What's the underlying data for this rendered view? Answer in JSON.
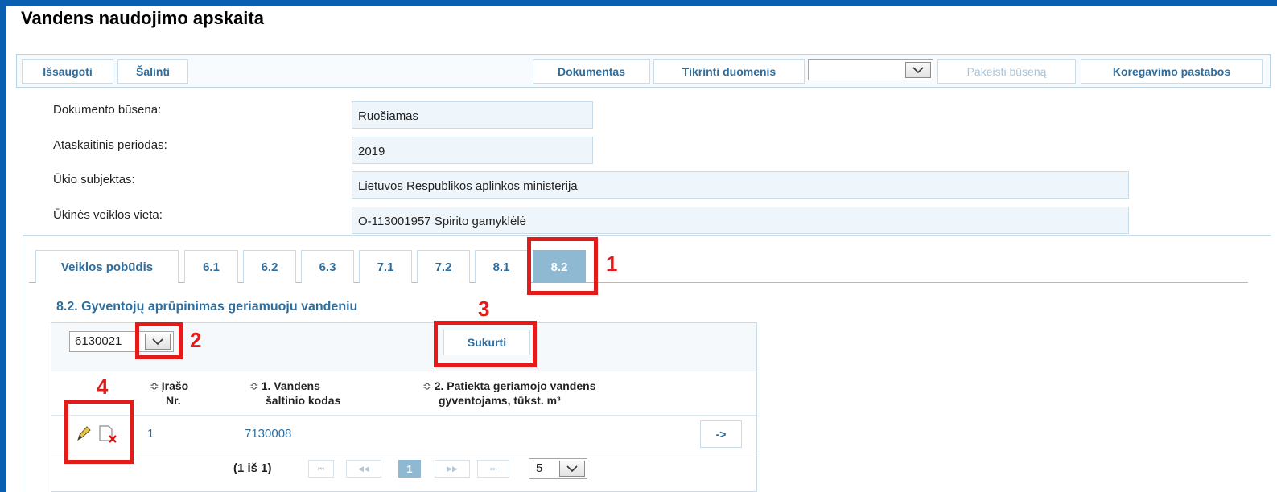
{
  "page": {
    "title": "Vandens naudojimo apskaita"
  },
  "toolbar": {
    "save": "Išsaugoti",
    "delete": "Šalinti",
    "document": "Dokumentas",
    "check": "Tikrinti duomenis",
    "status_select_value": "",
    "change_status": "Pakeisti būseną",
    "correction_notes": "Koregavimo pastabos"
  },
  "form": {
    "status_label": "Dokumento būsena:",
    "status_value": "Ruošiamas",
    "period_label": "Ataskaitinis periodas:",
    "period_value": "2019",
    "entity_label": "Ūkio subjektas:",
    "entity_value": "Lietuvos Respublikos aplinkos ministerija",
    "site_label": "Ūkinės veiklos vieta:",
    "site_value": "O-113001957 Spirito gamyklėlė"
  },
  "tabs": [
    "Veiklos pobūdis",
    "6.1",
    "6.2",
    "6.3",
    "7.1",
    "7.2",
    "8.1",
    "8.2"
  ],
  "active_tab": "8.2",
  "section": {
    "title": "8.2. Gyventojų aprūpinimas geriamuoju vandeniu",
    "select_value": "6130021",
    "create_button": "Sukurti"
  },
  "table": {
    "columns": [
      {
        "line1": "Įrašo",
        "line2": "Nr."
      },
      {
        "line1": "1. Vandens",
        "line2": "šaltinio kodas"
      },
      {
        "line1": "2. Patiekta geriamojo vandens",
        "line2": "gyventojams, tūkst. m³"
      }
    ],
    "rows": [
      {
        "nr": "1",
        "code": "7130008",
        "qty": "",
        "action": "->"
      }
    ],
    "sort_symbol": "≎"
  },
  "pagination": {
    "info": "(1 iš 1)",
    "first": "⏮",
    "prev": "◀◀",
    "current": "1",
    "next": "▶▶",
    "last": "⏭",
    "page_size": "5"
  },
  "annotations": [
    "1",
    "2",
    "3",
    "4"
  ],
  "colors": {
    "accent": "#2e6e9e",
    "active_tab": "#8fb9d3",
    "marker": "#e41b1b",
    "border": "#0a5fb0"
  },
  "icons": {
    "edit": "pencil-icon",
    "delete": "delete-record-icon",
    "dropdown": "chevron-down-icon"
  }
}
